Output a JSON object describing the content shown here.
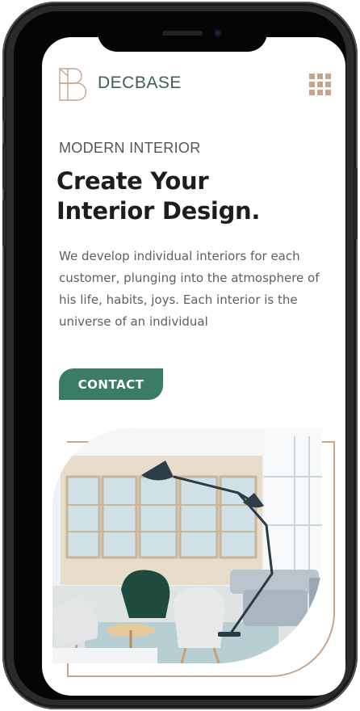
{
  "header": {
    "brand": "DECBASE",
    "logo_icon": "decbase-logo-icon",
    "menu_icon": "grid-menu-icon"
  },
  "hero": {
    "eyebrow": "MODERN INTERIOR",
    "headline_line1": "Create Your",
    "headline_line2": "Interior Design.",
    "description": "We develop individual interiors for each customer, plunging into the atmosphere of his life, habits, joys. Each interior is the universe of an individual",
    "cta_label": "CONTACT"
  },
  "colors": {
    "accent": "#3a7c68",
    "brand_text": "#3e5f55",
    "gold": "#c9a48c",
    "headline": "#1d1d1d",
    "body_text": "#5f5f5f"
  },
  "image": {
    "subject": "interior-photo"
  }
}
